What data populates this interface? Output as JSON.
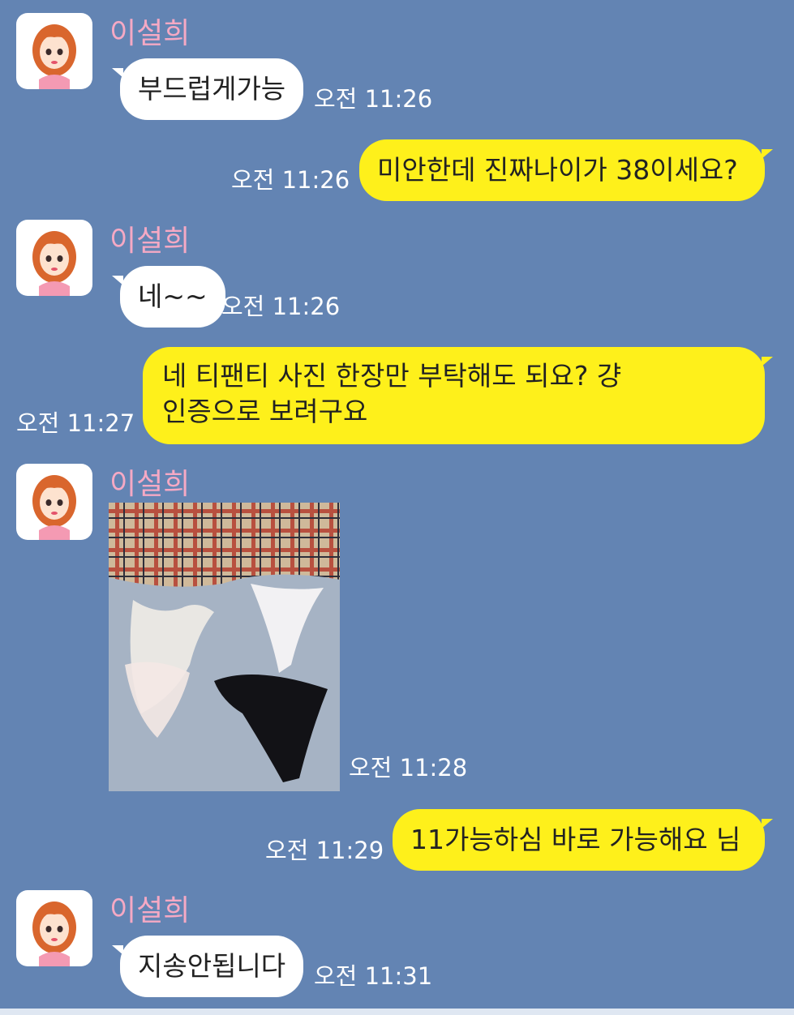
{
  "colors": {
    "background": "#6384b3",
    "incoming_bubble": "#ffffff",
    "outgoing_bubble": "#fef01b",
    "sender_name": "#f5a9c4",
    "timestamp": "#ffffff"
  },
  "sender": {
    "name": "이설희",
    "avatar_icon": "cartoon-girl-avatar-icon"
  },
  "messages": [
    {
      "direction": "in",
      "text": "부드럽게가능",
      "time": "오전 11:26"
    },
    {
      "direction": "out",
      "text": "미안한데 진짜나이가 38이세요?",
      "time": "오전 11:26"
    },
    {
      "direction": "in",
      "text": "네~~",
      "time": "오전 11:26"
    },
    {
      "direction": "out",
      "lines": [
        "네  티팬티 사진 한장만 부탁해도 되요? 걍",
        "인증으로 보려구요"
      ],
      "time": "오전 11:27"
    },
    {
      "direction": "in",
      "type": "photo",
      "time": "오전 11:28"
    },
    {
      "direction": "out",
      "text": "11가능하심 바로 가능해요 님",
      "time": "오전 11:29"
    },
    {
      "direction": "in",
      "text": "지송안됩니다",
      "time": "오전 11:31"
    }
  ]
}
